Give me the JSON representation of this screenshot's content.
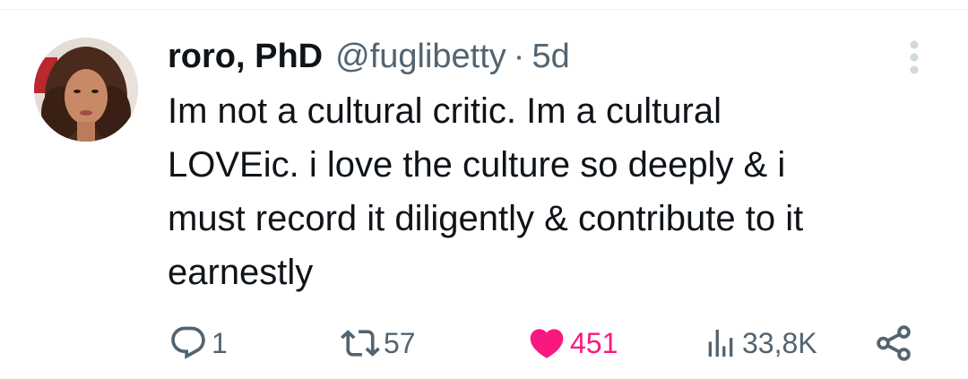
{
  "tweet": {
    "author": {
      "display_name": "roro, PhD",
      "handle": "@fuglibetty"
    },
    "separator": "·",
    "timestamp": "5d",
    "text_lines": [
      "Im not a cultural critic. Im a cultural",
      "LOVEic. i love the culture so deeply & i",
      "must record it diligently & contribute to it",
      "earnestly"
    ],
    "actions": {
      "reply_count": "1",
      "retweet_count": "57",
      "like_count": "451",
      "view_count": "33,8K"
    }
  },
  "icons": {
    "more": "more-vertical-icon",
    "reply": "reply-icon",
    "retweet": "retweet-icon",
    "like": "heart-filled-icon",
    "views": "views-bar-chart-icon",
    "share": "share-icon"
  },
  "colors": {
    "text_primary": "#0f1419",
    "text_secondary": "#536471",
    "like_pink": "#f91880",
    "divider": "#eff3f4"
  }
}
